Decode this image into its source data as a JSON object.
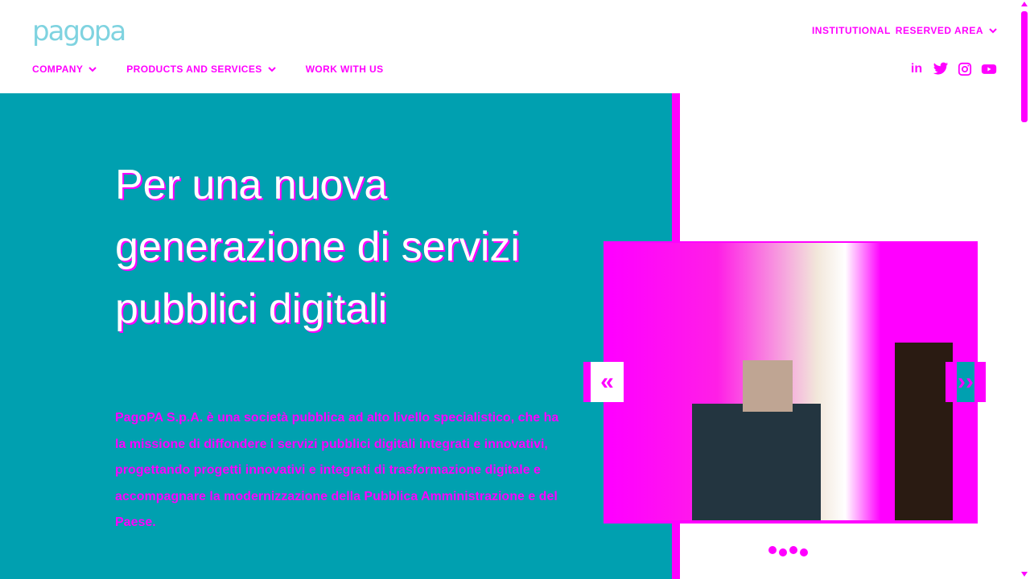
{
  "header": {
    "logo_text": "pagopa",
    "top_links": [
      "Institutional",
      "Reserved area"
    ],
    "main_nav": [
      "Company",
      "Products and services",
      "Work with us"
    ],
    "socials": [
      "linkedin",
      "twitter",
      "instagram",
      "youtube"
    ]
  },
  "hero": {
    "title": "Per una nuova generazione di servizi pubblici digitali",
    "description": "PagoPA S.p.A. è una società pubblica ad alto livello specialistico, che ha la missione di diffondere i servizi pubblici digitali integrati e innovativi, progettando progetti innovativi e integrati di trasformazione digitale e accompagnare la modernizzazione della Pubblica Amministrazione e del Paese."
  },
  "slider": {
    "prev_label": "«",
    "next_label": "››",
    "dot_count": 4
  },
  "colors": {
    "accent": "#ff00ff",
    "hero_bg": "#00a0b0",
    "logo": "#7fd3e0"
  }
}
